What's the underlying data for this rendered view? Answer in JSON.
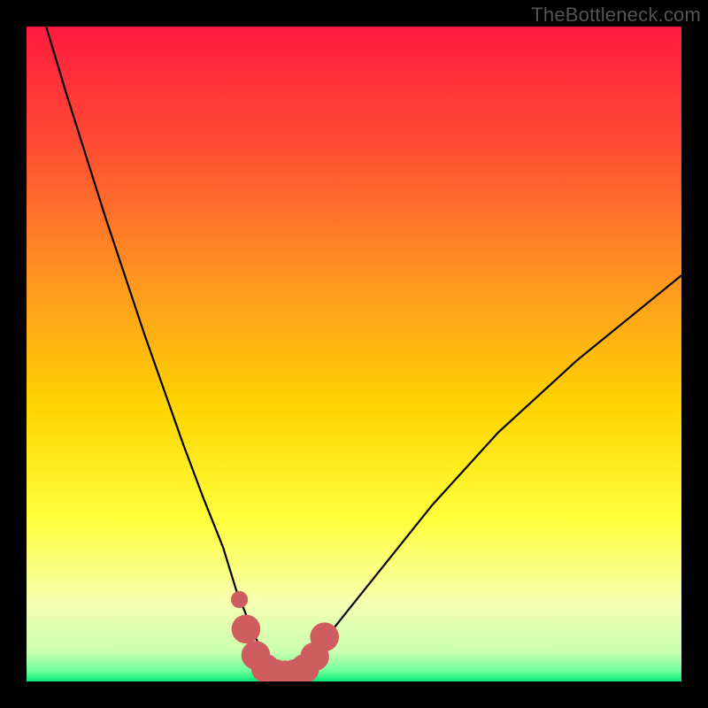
{
  "attribution": "TheBottleneck.com",
  "colors": {
    "frame": "#000000",
    "gradient_top": "#ff1a3e",
    "gradient_mid_upper": "#ff7a2a",
    "gradient_mid": "#ffd400",
    "gradient_mid_lower": "#ffff3a",
    "gradient_lower": "#f8ffb0",
    "gradient_bottom": "#00e874",
    "curve": "#000000",
    "marker_fill": "#cf5d60",
    "marker_stroke": "#cf5d60"
  },
  "chart_data": {
    "type": "line",
    "title": "",
    "xlabel": "",
    "ylabel": "",
    "xlim": [
      0,
      100
    ],
    "ylim": [
      0,
      100
    ],
    "series": [
      {
        "name": "bottleneck-curve",
        "x": [
          3,
          6,
          9,
          12,
          15,
          18,
          21,
          24,
          27,
          30,
          32,
          34,
          35.5,
          37,
          38.5,
          40,
          42,
          44,
          48,
          54,
          62,
          72,
          84,
          100
        ],
        "values": [
          100,
          90,
          80.5,
          71,
          62,
          53,
          44.5,
          36,
          28,
          20.5,
          14,
          9,
          5.5,
          3,
          1.5,
          1,
          2,
          4.5,
          9.5,
          17,
          27,
          38,
          49,
          62
        ]
      }
    ],
    "markers": {
      "name": "highlight-band",
      "points": [
        {
          "x": 32.5,
          "y": 12.5,
          "r": 1.3
        },
        {
          "x": 33.5,
          "y": 8.0,
          "r": 2.2
        },
        {
          "x": 35.0,
          "y": 4.0,
          "r": 2.2
        },
        {
          "x": 36.5,
          "y": 2.0,
          "r": 2.2
        },
        {
          "x": 38.0,
          "y": 1.2,
          "r": 2.2
        },
        {
          "x": 39.5,
          "y": 1.0,
          "r": 2.2
        },
        {
          "x": 41.0,
          "y": 1.2,
          "r": 2.2
        },
        {
          "x": 42.5,
          "y": 2.0,
          "r": 2.2
        },
        {
          "x": 44.0,
          "y": 3.8,
          "r": 2.2
        },
        {
          "x": 45.5,
          "y": 6.8,
          "r": 2.2
        }
      ]
    },
    "gradient_stops": [
      {
        "offset": 0.0,
        "color": "#ff1a3e"
      },
      {
        "offset": 0.18,
        "color": "#ff4c33"
      },
      {
        "offset": 0.4,
        "color": "#ff9a1f"
      },
      {
        "offset": 0.58,
        "color": "#ffd400"
      },
      {
        "offset": 0.75,
        "color": "#ffff3a"
      },
      {
        "offset": 0.88,
        "color": "#f6ffb0"
      },
      {
        "offset": 0.955,
        "color": "#c9ffb0"
      },
      {
        "offset": 0.985,
        "color": "#6aff9a"
      },
      {
        "offset": 1.0,
        "color": "#00e874"
      }
    ]
  }
}
